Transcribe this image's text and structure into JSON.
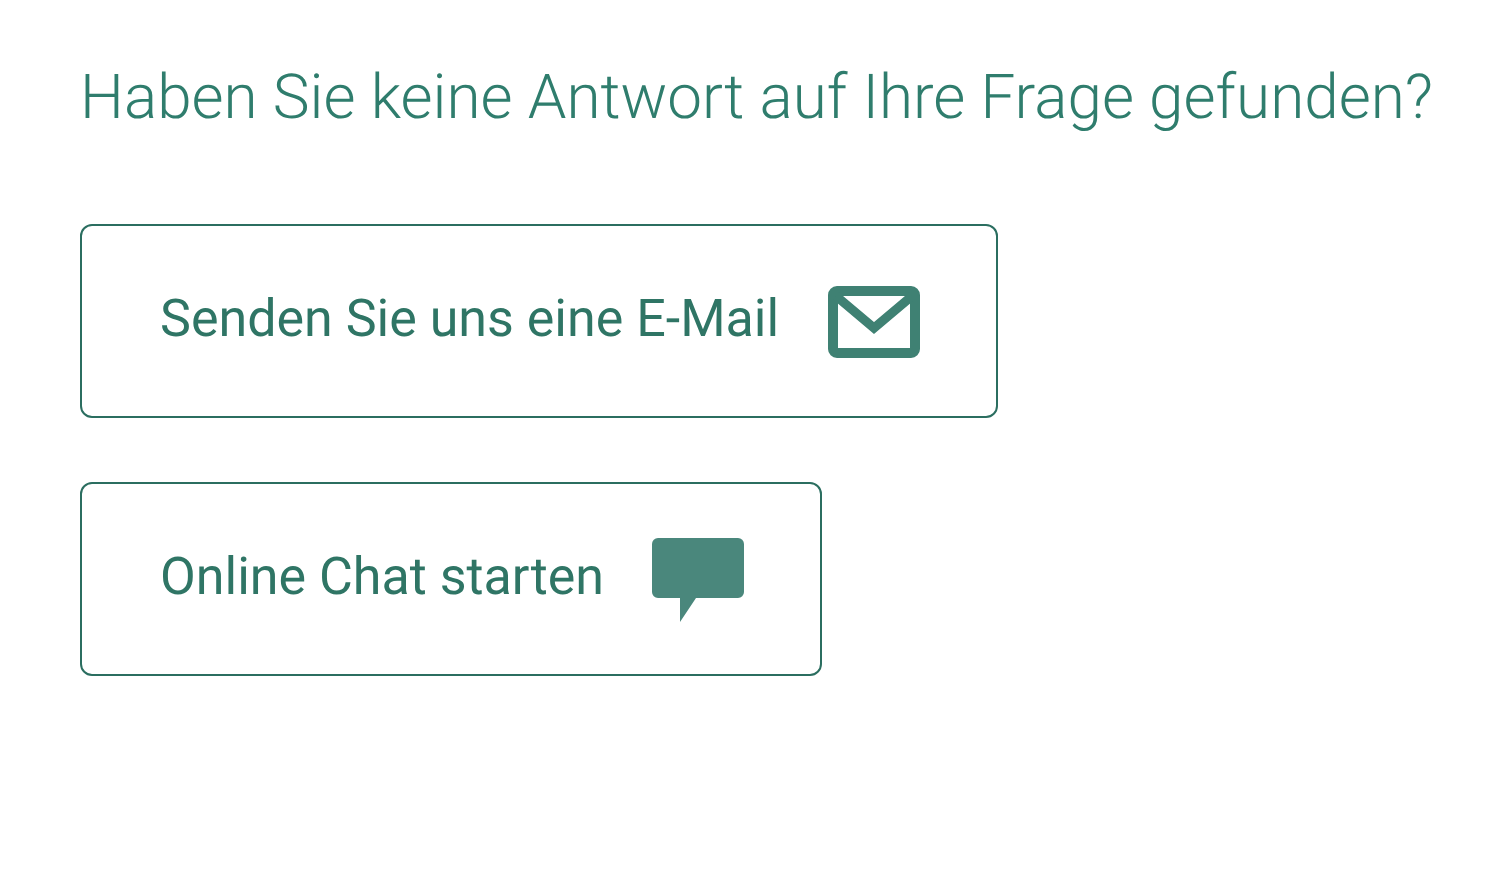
{
  "heading": "Haben Sie keine Antwort auf Ihre Frage gefunden?",
  "buttons": [
    {
      "label": "Senden Sie uns eine E-Mail",
      "kind": "email"
    },
    {
      "label": "Online Chat starten",
      "kind": "chat"
    }
  ]
}
